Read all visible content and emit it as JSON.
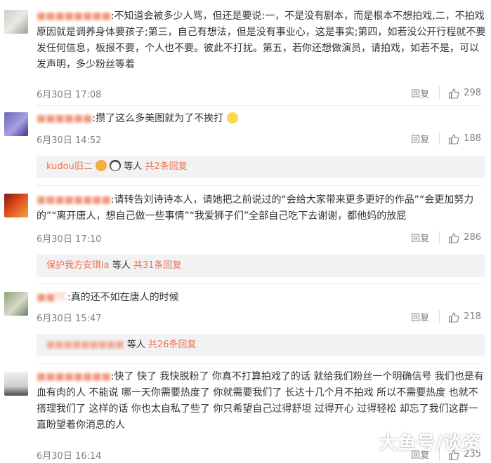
{
  "comments": [
    {
      "username": "■■■■■■■■",
      "text": "不知道会被多少人骂，但还是要说:一，不是没有剧本，而是根本不想拍戏,二，不拍戏原因就是调养身体要孩子;第三，自己有想法，但是没有事业心，这是事实;第四，如若没公开行程就不要发任何信息，板报不要，个人也不要。彼此不打扰。第五，若你还想做演员，请拍戏，如若不是，可以发声明，多少粉丝等着",
      "date": "6月30日 17:08",
      "reply_label": "回复",
      "likes": "298"
    },
    {
      "username": "■■■■■■",
      "text": "攒了这么多美图就为了不挨打",
      "date": "6月30日 14:52",
      "reply_label": "回复",
      "likes": "188",
      "replies": {
        "names": "kudou旧二",
        "suffix": "等人",
        "count": "共2条回复"
      }
    },
    {
      "username": "■■■■■■■■",
      "text": "请转告刘诗诗本人，请她把之前说过的“会给大家带来更多更好的作品”“会更加努力的”“离开唐人，想自己做一些事情”“我爱狮子们”全部自己吃下去谢谢，都他妈的放屁",
      "date": "6月30日 17:10",
      "reply_label": "回复",
      "likes": "286",
      "replies": {
        "names": "保护我方安琪la",
        "suffix": "等人",
        "count": "共31条回复"
      }
    },
    {
      "username": "■■TC",
      "text": "真的还不如在唐人的时候",
      "date": "6月30日 15:47",
      "reply_label": "回复",
      "likes": "218",
      "replies": {
        "names": "■■■■■■■■■",
        "suffix": "等人",
        "count": "共26条回复"
      }
    },
    {
      "username": "■■■■■■■■",
      "text": "快了 快了 我快脱粉了 你真不打算拍戏了的话 就给我们粉丝一个明确信号 我们也是有血有肉的人 不能说 哪一天你需要热度了 你就需要我们了 长达十几个月不拍戏 所以不需要热度 也就不搭理我们了 这样的话 你也太自私了些了 你只希望自己过得舒坦 过得开心 过得轻松 却忘了我们这群一直盼望着你消息的人",
      "date": "6月30日 16:14",
      "reply_label": "回复",
      "likes": "235"
    }
  ],
  "watermark": "大鱼号/谈资",
  "colors": {
    "accent": "#eb7350",
    "meta": "#808080",
    "reply_bg": "#f2f2f5"
  },
  "icons": {
    "like": "thumbs-up-icon",
    "emoji": "laughing-emoji-icon"
  }
}
